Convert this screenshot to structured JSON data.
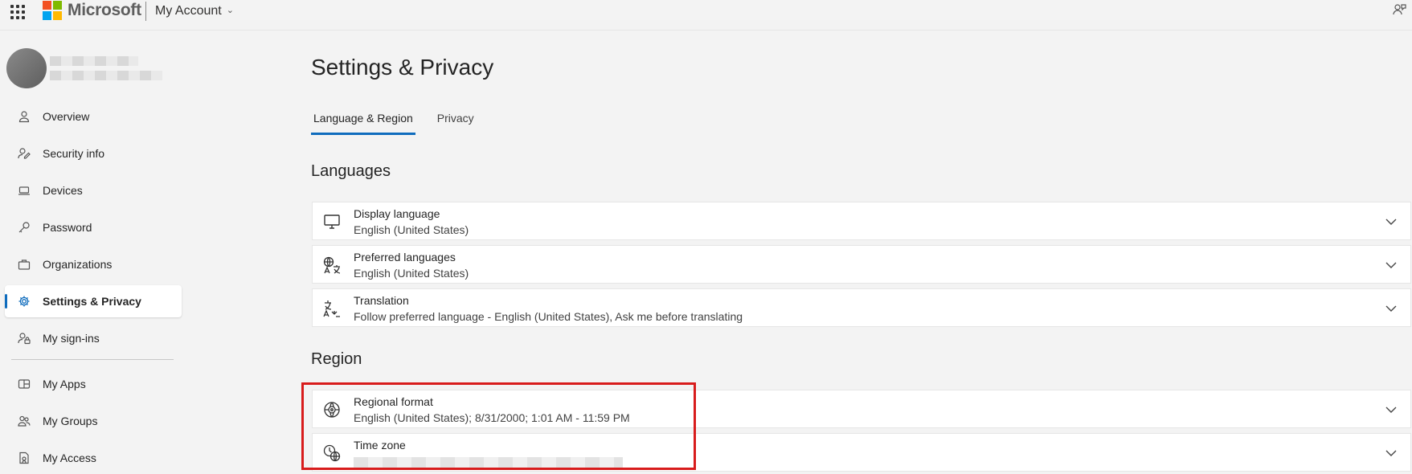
{
  "header": {
    "brand": "Microsoft",
    "account_label": "My Account",
    "logo_colors": [
      "#f25022",
      "#7fba00",
      "#00a4ef",
      "#ffb900"
    ]
  },
  "sidebar": {
    "items": [
      {
        "label": "Overview",
        "icon": "person-icon"
      },
      {
        "label": "Security info",
        "icon": "security-icon"
      },
      {
        "label": "Devices",
        "icon": "laptop-icon"
      },
      {
        "label": "Password",
        "icon": "key-icon"
      },
      {
        "label": "Organizations",
        "icon": "briefcase-icon"
      },
      {
        "label": "Settings & Privacy",
        "icon": "gear-icon",
        "active": true
      },
      {
        "label": "My sign-ins",
        "icon": "person-lock-icon"
      },
      {
        "label": "My Apps",
        "icon": "apps-icon"
      },
      {
        "label": "My Groups",
        "icon": "people-icon"
      },
      {
        "label": "My Access",
        "icon": "access-icon"
      }
    ]
  },
  "main": {
    "title": "Settings & Privacy",
    "tabs": [
      {
        "label": "Language & Region",
        "active": true
      },
      {
        "label": "Privacy",
        "active": false
      }
    ],
    "languages_heading": "Languages",
    "languages": [
      {
        "title": "Display language",
        "value": "English (United States)",
        "icon": "monitor-icon"
      },
      {
        "title": "Preferred languages",
        "value": "English (United States)",
        "icon": "globe-language-icon"
      },
      {
        "title": "Translation",
        "value": "Follow preferred language - English (United States), Ask me before translating",
        "icon": "translate-icon"
      }
    ],
    "region_heading": "Region",
    "region": [
      {
        "title": "Regional format",
        "value": "English (United States); 8/31/2000; 1:01 AM - 11:59 PM",
        "icon": "globe-location-icon"
      },
      {
        "title": "Time zone",
        "icon": "clock-globe-icon"
      }
    ]
  },
  "colors": {
    "accent": "#0f6cbd",
    "highlight_box": "#d81c1c"
  }
}
